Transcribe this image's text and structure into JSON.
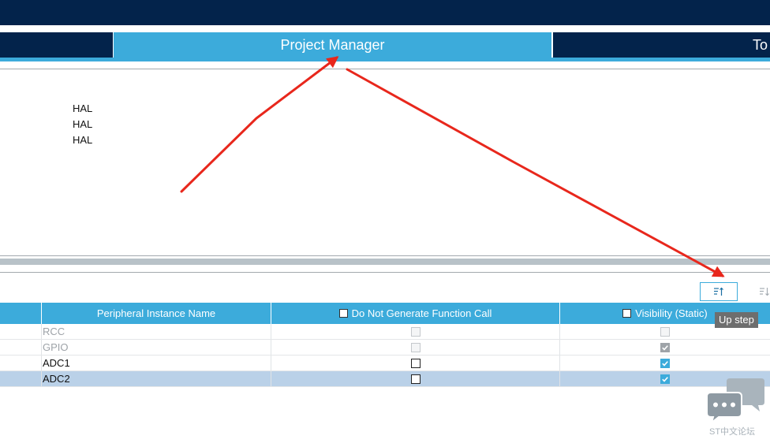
{
  "tabs": [
    {
      "label": "",
      "active": false
    },
    {
      "label": "Project Manager",
      "active": true
    },
    {
      "label": "To",
      "active": false
    }
  ],
  "upper_panel": {
    "hal_items": [
      "HAL",
      "HAL",
      "HAL"
    ]
  },
  "toolbar": {
    "up_step_icon": "sort-up-icon",
    "down_step_icon": "sort-down-icon",
    "up_step_tooltip": "Up step"
  },
  "table": {
    "columns": [
      {
        "label": "",
        "has_checkbox": false
      },
      {
        "label": "Peripheral Instance Name",
        "has_checkbox": false
      },
      {
        "label": "Do Not Generate Function Call",
        "has_checkbox": true
      },
      {
        "label": "Visibility (Static)",
        "has_checkbox": true
      }
    ],
    "rows": [
      {
        "name": "RCC",
        "enabled": false,
        "do_not_generate": false,
        "visibility": false,
        "selected": false
      },
      {
        "name": "GPIO",
        "enabled": false,
        "do_not_generate": false,
        "visibility": true,
        "selected": false
      },
      {
        "name": "ADC1",
        "enabled": true,
        "do_not_generate": false,
        "visibility": true,
        "selected": false
      },
      {
        "name": "ADC2",
        "enabled": true,
        "do_not_generate": false,
        "visibility": true,
        "selected": true
      }
    ]
  },
  "watermark": {
    "label": "ST中文论坛",
    "icon": "chat-bubbles-icon"
  },
  "colors": {
    "navy": "#03234b",
    "accent": "#3cabdb",
    "selected_row": "#bad1e8",
    "annotation_arrow": "#e8271c",
    "tooltip_bg": "#6e6e6e"
  }
}
